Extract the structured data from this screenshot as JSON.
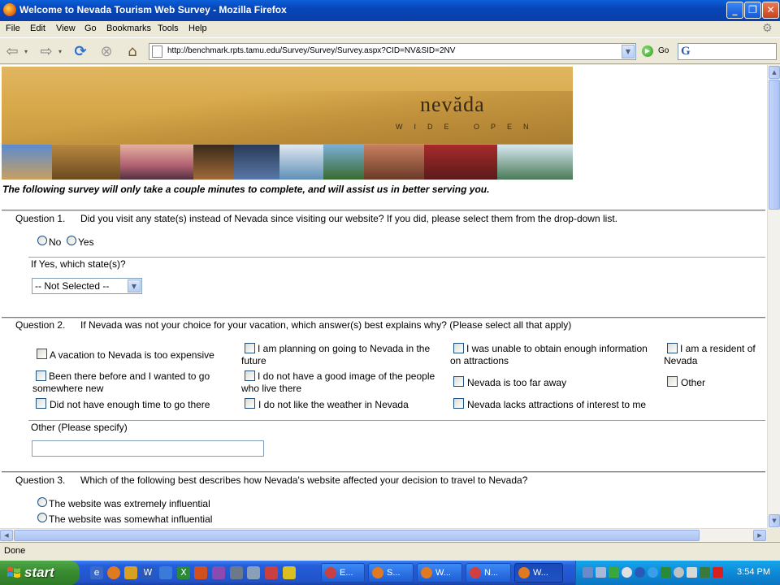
{
  "window": {
    "title": "Welcome to Nevada Tourism Web Survey - Mozilla Firefox",
    "min_glyph": "_",
    "max_glyph": "❐",
    "close_glyph": "✕"
  },
  "menu": {
    "items": [
      "File",
      "Edit",
      "View",
      "Go",
      "Bookmarks",
      "Tools",
      "Help"
    ]
  },
  "nav": {
    "url": "http://benchmark.rpts.tamu.edu/Survey/Survey/Survey.aspx?CID=NV&SID=2NV",
    "go_label": "Go",
    "search_glyph": "G"
  },
  "banner": {
    "brand": "nevăda",
    "tagline": "WIDE OPEN"
  },
  "survey": {
    "intro": "The following survey will only take a couple minutes to complete, and will assist us in better serving you.",
    "q1": {
      "number": "Question 1.",
      "text": "Did you visit any state(s) instead of Nevada since visiting our website? If you did, please select them from the drop-down list.",
      "options": [
        "No",
        "Yes"
      ],
      "followup_label": "If Yes, which state(s)?",
      "select_value": "-- Not Selected --"
    },
    "q2": {
      "number": "Question 2.",
      "text": "If Nevada was not your choice for your vacation, which answer(s) best explains why? (Please select all that apply)",
      "options": [
        "A vacation to Nevada is too expensive",
        "I am planning on going to Nevada in the future",
        "I was unable to obtain enough information on attractions",
        "I am a resident of Nevada",
        "Been there before and I wanted to go somewhere new",
        "I do not have a good image of the people who live there",
        "Nevada is too far away",
        "Other",
        "Did not have enough time to go there",
        "I do not like the weather in Nevada",
        "Nevada lacks attractions of interest to me"
      ],
      "other_label": "Other (Please specify)",
      "other_value": ""
    },
    "q3": {
      "number": "Question 3.",
      "text": "Which of the following best describes how Nevada's website affected your decision to travel to Nevada?",
      "options": [
        "The website was extremely influential",
        "The website was somewhat influential"
      ]
    }
  },
  "status": {
    "text": "Done"
  },
  "taskbar": {
    "start_label": "start",
    "buttons": [
      "E...",
      "S...",
      "W...",
      "N...",
      "W..."
    ],
    "clock": "3:54 PM"
  }
}
